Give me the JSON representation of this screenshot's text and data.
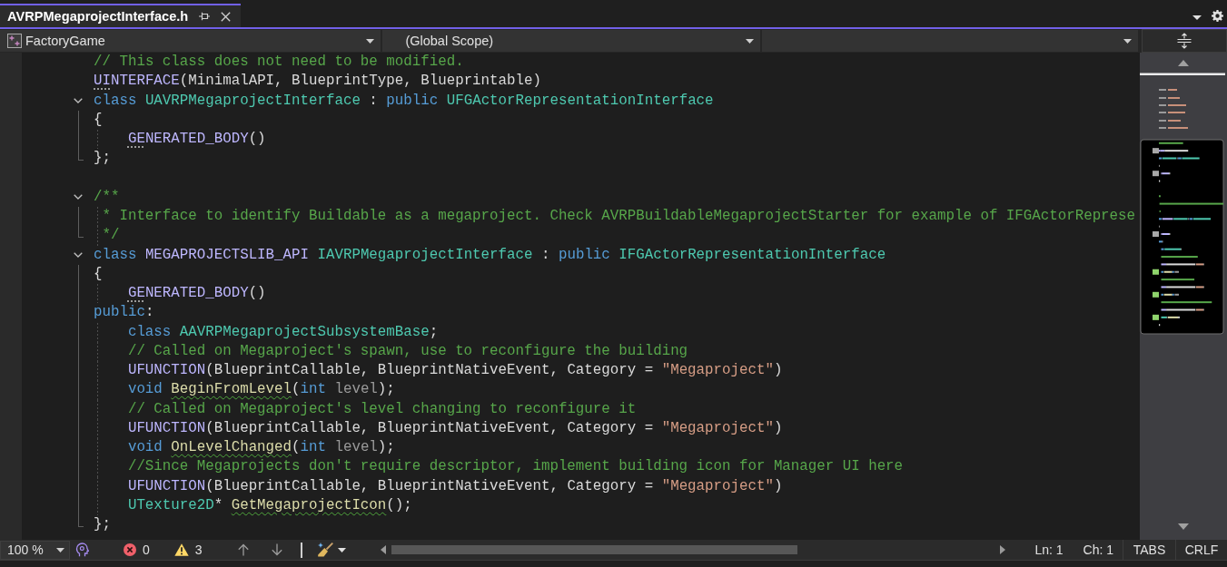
{
  "tabs": [
    {
      "label": "AVRPMegaprojectInterface.h",
      "selected": true
    }
  ],
  "navigation": {
    "project": "FactoryGame",
    "scope": "(Global Scope)"
  },
  "code": {
    "lines": [
      {
        "kind": "code",
        "tokens": [
          {
            "text": "// This class does not need to be modified.",
            "kind": "comment"
          }
        ]
      },
      {
        "kind": "code",
        "tokens": [
          {
            "text": "UI",
            "kind": "macro",
            "dots": true
          },
          {
            "text": "NTERFACE",
            "kind": "macro"
          },
          {
            "text": "(MinimalAPI, BlueprintType, Blueprintable)",
            "kind": "plain"
          }
        ]
      },
      {
        "kind": "code",
        "tokens": [
          {
            "text": "class",
            "kind": "keyword"
          },
          {
            "text": " UAVRPMegaprojectInterface",
            "kind": "type"
          },
          {
            "text": " : ",
            "kind": "plain"
          },
          {
            "text": "public",
            "kind": "keyword"
          },
          {
            "text": " UFGActorRepresentationInterface",
            "kind": "type"
          }
        ],
        "expanded": true,
        "children": [
          {
            "tokens": [
              {
                "text": "{",
                "kind": "plain"
              }
            ]
          },
          {
            "tokens": [
              {
                "text": "    GE",
                "kind": "macro",
                "dots": true
              },
              {
                "text": "NERATED_BODY",
                "kind": "macro"
              },
              {
                "text": "()",
                "kind": "plain"
              }
            ]
          },
          {
            "tokens": [
              {
                "text": "};",
                "kind": "plain"
              }
            ]
          }
        ]
      },
      {
        "kind": "blank"
      },
      {
        "kind": "code",
        "tokens": [
          {
            "text": "/**",
            "kind": "comment"
          }
        ],
        "expanded": true,
        "children": [
          {
            "tokens": [
              {
                "text": " * Interface to identify Buildable as a megaproject. Check AVRPBuildableMegaprojectStarter for example of IFGActorReprese",
                "kind": "comment"
              }
            ]
          },
          {
            "tokens": [
              {
                "text": " */",
                "kind": "comment"
              }
            ]
          }
        ]
      },
      {
        "kind": "code",
        "tokens": [
          {
            "text": "class",
            "kind": "keyword"
          },
          {
            "text": " MEGAPROJECTSLIB_API",
            "kind": "macro"
          },
          {
            "text": " IAVRPMegaprojectInterface",
            "kind": "type"
          },
          {
            "text": " : ",
            "kind": "plain"
          },
          {
            "text": "public",
            "kind": "keyword"
          },
          {
            "text": " IFGActorRepresentationInterface",
            "kind": "type"
          }
        ],
        "expanded": true,
        "children": [
          {
            "tokens": [
              {
                "text": "{",
                "kind": "plain"
              }
            ]
          },
          {
            "tokens": [
              {
                "text": "    GE",
                "kind": "macro",
                "dots": true
              },
              {
                "text": "NERATED_BODY",
                "kind": "macro"
              },
              {
                "text": "()",
                "kind": "plain"
              }
            ]
          },
          {
            "tokens": [
              {
                "text": "public",
                "kind": "keyword"
              },
              {
                "text": ":",
                "kind": "plain"
              }
            ]
          },
          {
            "tokens": [
              {
                "text": "    class",
                "kind": "keyword"
              },
              {
                "text": " AAVRPMegaprojectSubsystemBase",
                "kind": "type"
              },
              {
                "text": ";",
                "kind": "plain"
              }
            ]
          },
          {
            "tokens": [
              {
                "text": "    // Called on Megaproject's spawn, use to reconfigure the building",
                "kind": "comment"
              }
            ]
          },
          {
            "tokens": [
              {
                "text": "    UFUNCTION",
                "kind": "macro"
              },
              {
                "text": "(BlueprintCallable, BlueprintNativeEvent, Category = ",
                "kind": "plain"
              },
              {
                "text": "\"Megaproject\"",
                "kind": "string"
              },
              {
                "text": ")",
                "kind": "plain"
              }
            ]
          },
          {
            "tokens": [
              {
                "text": "    void ",
                "kind": "keyword"
              },
              {
                "text": "BeginFromLevel",
                "kind": "function",
                "squiggle": true
              },
              {
                "text": "(",
                "kind": "plain"
              },
              {
                "text": "int",
                "kind": "keyword"
              },
              {
                "text": " level",
                "kind": "param"
              },
              {
                "text": ");",
                "kind": "plain"
              }
            ]
          },
          {
            "tokens": [
              {
                "text": "    // Called on Megaproject's level changing to reconfigure it",
                "kind": "comment"
              }
            ]
          },
          {
            "tokens": [
              {
                "text": "    UFUNCTION",
                "kind": "macro"
              },
              {
                "text": "(BlueprintCallable, BlueprintNativeEvent, Category = ",
                "kind": "plain"
              },
              {
                "text": "\"Megaproject\"",
                "kind": "string"
              },
              {
                "text": ")",
                "kind": "plain"
              }
            ]
          },
          {
            "tokens": [
              {
                "text": "    void ",
                "kind": "keyword"
              },
              {
                "text": "OnLevelChanged",
                "kind": "function",
                "squiggle": true
              },
              {
                "text": "(",
                "kind": "plain"
              },
              {
                "text": "int",
                "kind": "keyword"
              },
              {
                "text": " level",
                "kind": "param"
              },
              {
                "text": ");",
                "kind": "plain"
              }
            ]
          },
          {
            "tokens": [
              {
                "text": "    //Since Megaprojects don't require descriptor, implement building icon for Manager UI here",
                "kind": "comment"
              }
            ]
          },
          {
            "tokens": [
              {
                "text": "    UFUNCTION",
                "kind": "macro"
              },
              {
                "text": "(BlueprintCallable, BlueprintNativeEvent, Category = ",
                "kind": "plain"
              },
              {
                "text": "\"Megaproject\"",
                "kind": "string"
              },
              {
                "text": ")",
                "kind": "plain"
              }
            ]
          },
          {
            "tokens": [
              {
                "text": "    UTexture2D",
                "kind": "type"
              },
              {
                "text": "* ",
                "kind": "plain"
              },
              {
                "text": "GetMegaprojectIcon",
                "kind": "function",
                "squiggle": true
              },
              {
                "text": "();",
                "kind": "plain"
              }
            ]
          },
          {
            "tokens": [
              {
                "text": "};",
                "kind": "plain"
              }
            ]
          }
        ]
      }
    ]
  },
  "status_bar": {
    "zoom": "100 %",
    "errors": "0",
    "warnings": "3",
    "line": "Ln: 1",
    "column": "Ch: 1",
    "indentation": "TABS",
    "line_endings": "CRLF"
  }
}
